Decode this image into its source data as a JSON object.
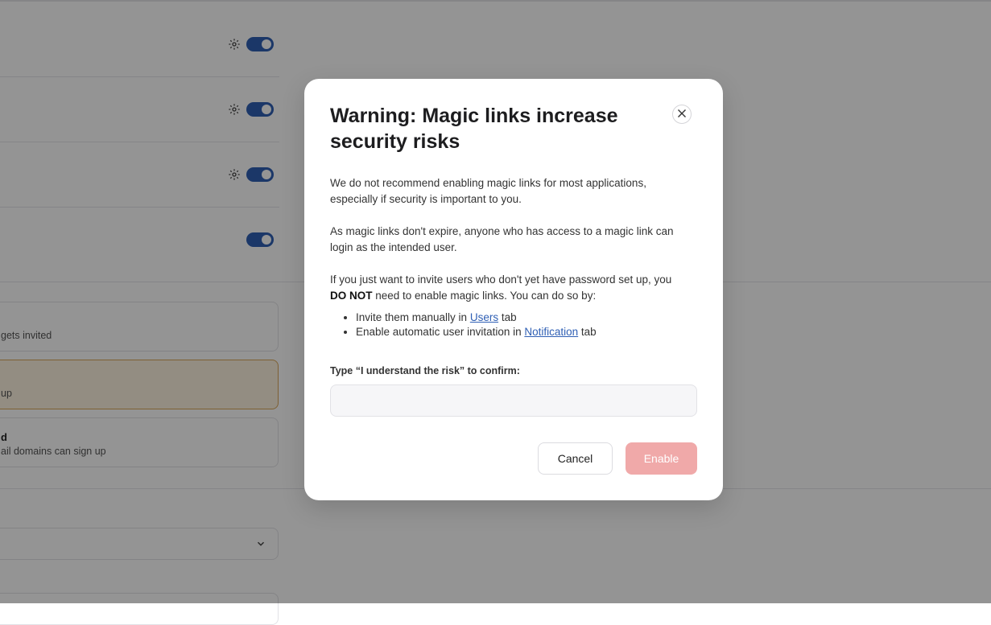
{
  "modal": {
    "title": "Warning: Magic links increase security risks",
    "paragraph1": "We do not recommend enabling magic links for most applications, especially if security is important to you.",
    "paragraph2": "As magic links don't expire, anyone who has access to a magic link can login as the intended user.",
    "paragraph3_prefix": "If you just want to invite users who don't yet have password set up, you ",
    "paragraph3_emphasis": "DO NOT",
    "paragraph3_suffix": " need to enable magic links. You can do so by:",
    "list": [
      {
        "prefix": "Invite them manually in ",
        "link": "Users",
        "suffix": " tab"
      },
      {
        "prefix": "Enable automatic user invitation in ",
        "link": "Notification",
        "suffix": " tab"
      }
    ],
    "confirm_label": "Type “I understand the risk” to confirm:",
    "confirm_value": "",
    "cancel_label": "Cancel",
    "enable_label": "Enable"
  },
  "background": {
    "options": [
      {
        "title": "",
        "description": "gets invited"
      },
      {
        "title": "",
        "description": "up"
      },
      {
        "title": "d",
        "description": "ail domains can sign up"
      }
    ],
    "toggles_on": [
      true,
      true,
      true,
      true
    ]
  },
  "colors": {
    "accent": "#2f5fb4",
    "enable_disabled": "#f0a9a9",
    "selected_option_bg": "#fdf3e1",
    "selected_option_border": "#d9a657",
    "overlay": "rgba(0,0,0,0.42)"
  },
  "icons": {
    "close": "close-icon",
    "gear": "gear-icon",
    "chevron": "chevron-down-icon"
  }
}
